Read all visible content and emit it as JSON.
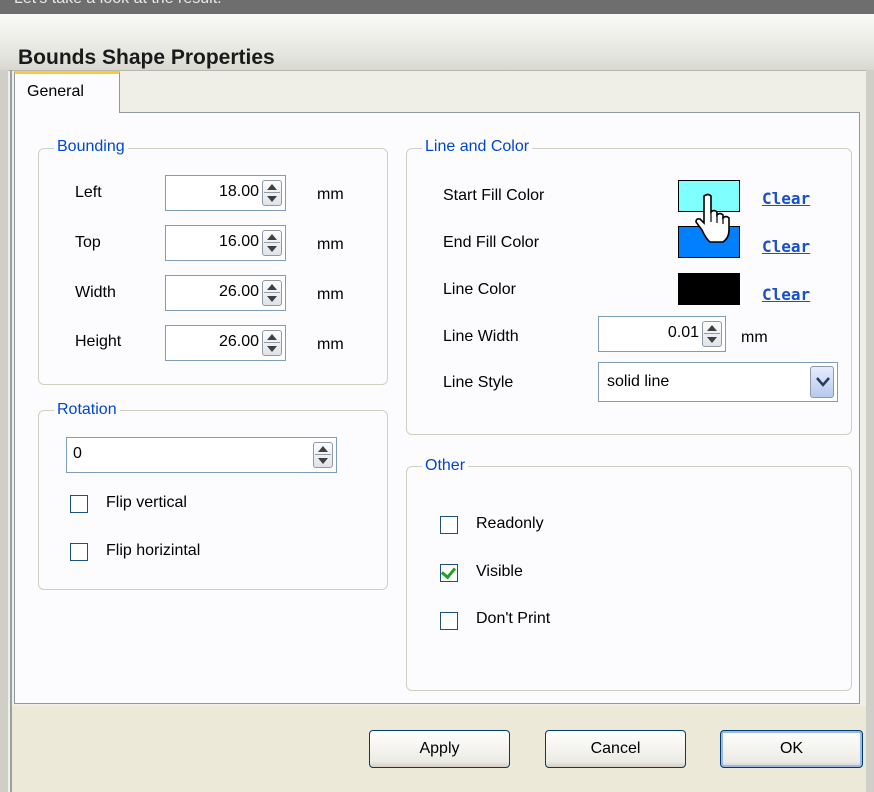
{
  "background_caption": "Let's take a look at the result.",
  "window": {
    "title": "Bounds Shape Properties"
  },
  "tabs": [
    {
      "label": "General",
      "selected": true
    }
  ],
  "bounding": {
    "title": "Bounding",
    "fields": [
      {
        "label": "Left",
        "value": "18.00",
        "unit": "mm"
      },
      {
        "label": "Top",
        "value": "16.00",
        "unit": "mm"
      },
      {
        "label": "Width",
        "value": "26.00",
        "unit": "mm"
      },
      {
        "label": "Height",
        "value": "26.00",
        "unit": "mm"
      }
    ]
  },
  "rotation": {
    "title": "Rotation",
    "value": "0",
    "flip_vertical": {
      "label": "Flip vertical",
      "checked": false
    },
    "flip_horizontal": {
      "label": "Flip horizintal",
      "checked": false
    }
  },
  "line_and_color": {
    "title": "Line and Color",
    "start_fill": {
      "label": "Start Fill Color",
      "color": "#80ffff",
      "clear_label": "Clear"
    },
    "end_fill": {
      "label": "End Fill Color",
      "color": "#0080ff",
      "clear_label": "Clear"
    },
    "line_color": {
      "label": "Line Color",
      "color": "#000000",
      "clear_label": "Clear"
    },
    "line_width": {
      "label": "Line Width",
      "value": "0.01",
      "unit": "mm"
    },
    "line_style": {
      "label": "Line Style",
      "value": "solid line"
    }
  },
  "other": {
    "title": "Other",
    "readonly": {
      "label": "Readonly",
      "checked": false
    },
    "visible": {
      "label": "Visible",
      "checked": true
    },
    "dont_print": {
      "label": "Don't Print",
      "checked": false
    }
  },
  "buttons": {
    "apply": "Apply",
    "cancel": "Cancel",
    "ok": "OK"
  },
  "icons": {
    "cursor": "hand-pointer-icon",
    "spin": "spin-arrows-icon",
    "dropdown": "chevron-down-icon",
    "check": "checkmark-icon"
  }
}
